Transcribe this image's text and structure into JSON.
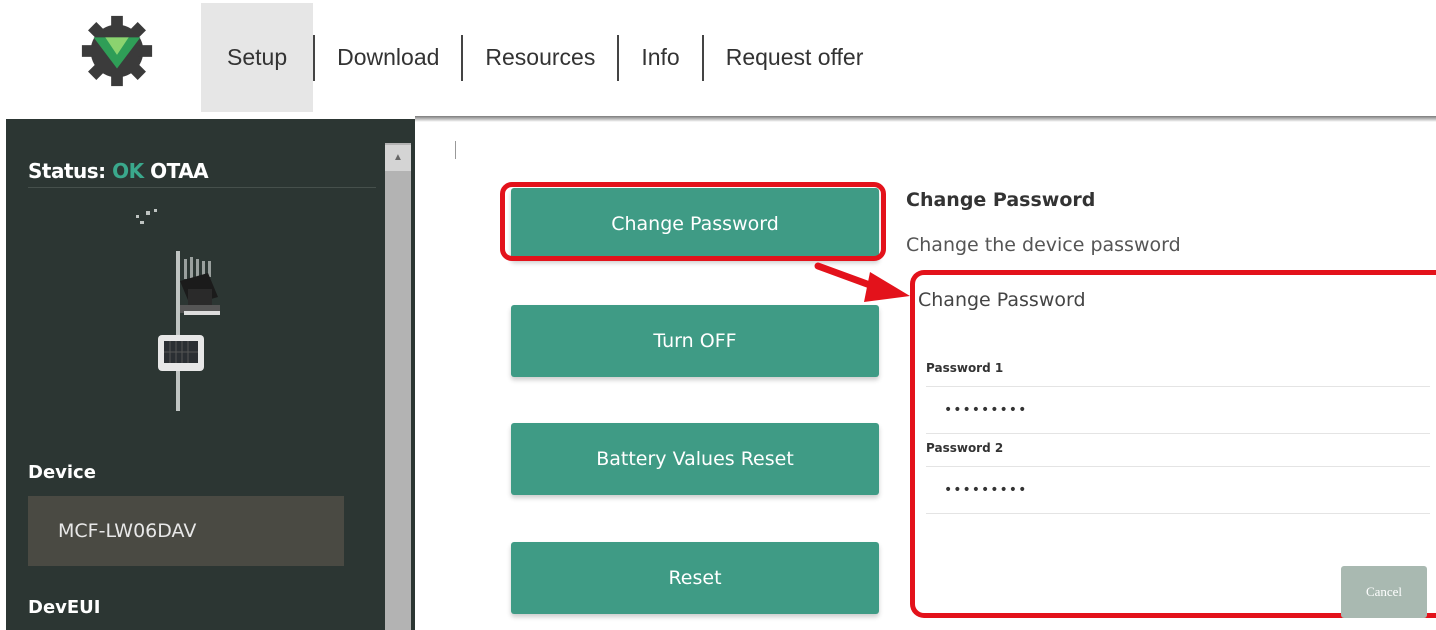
{
  "nav": {
    "items": [
      {
        "label": "Setup"
      },
      {
        "label": "Download"
      },
      {
        "label": "Resources"
      },
      {
        "label": "Info"
      },
      {
        "label": "Request offer"
      }
    ],
    "active": "Setup"
  },
  "sidebar": {
    "status_prefix": "Status:",
    "status_ok": "OK",
    "status_mode": "OTAA",
    "device_label": "Device",
    "device_value": "MCF-LW06DAV",
    "deveui_label": "DevEUI"
  },
  "actions": {
    "change_password": "Change Password",
    "turn_off": "Turn OFF",
    "battery_reset": "Battery Values Reset",
    "reset": "Reset"
  },
  "detail": {
    "title": "Change Password",
    "description": "Change the device password",
    "form_title": "Change Password",
    "password1_label": "Password 1",
    "password1_value": "•••••••••",
    "password2_label": "Password 2",
    "password2_value": "•••••••••",
    "cancel": "Cancel"
  },
  "colors": {
    "accent": "#3f9b85",
    "status_ok": "#3aa88c",
    "highlight": "#e3121b",
    "sidebar": "#2c3633"
  }
}
